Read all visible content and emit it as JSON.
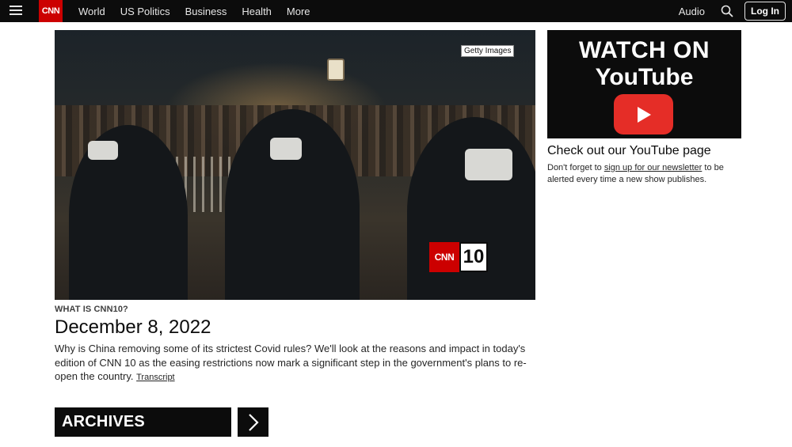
{
  "nav": {
    "logo": "CNN",
    "links": [
      "World",
      "US Politics",
      "Business",
      "Health",
      "More"
    ],
    "audio": "Audio",
    "login": "Log In"
  },
  "hero": {
    "credit": "Getty Images",
    "badge_logo": "CNN",
    "badge_number": "10"
  },
  "article": {
    "kicker": "WHAT IS CNN10?",
    "headline": "December 8, 2022",
    "description": "Why is China removing some of its strictest Covid rules? We'll look at the reasons and impact in today's edition of CNN 10 as the easing restrictions now mark a significant step in the government's plans to re-open the country.",
    "transcript_link": "Transcript"
  },
  "archives": {
    "label": "ARCHIVES"
  },
  "youtube": {
    "banner_line1": "WATCH ON",
    "banner_line2": "YouTube",
    "heading": "Check out our YouTube page",
    "desc_before": "Don't forget to ",
    "desc_link": "sign up for our newsletter",
    "desc_after": " to be alerted every time a new show publishes."
  },
  "colors": {
    "brand_red": "#cc0000",
    "youtube_red": "#e52d27",
    "nav_bg": "#0c0c0c"
  },
  "icons": [
    "hamburger-menu-icon",
    "search-icon",
    "chevron-right-icon",
    "youtube-play-icon"
  ]
}
